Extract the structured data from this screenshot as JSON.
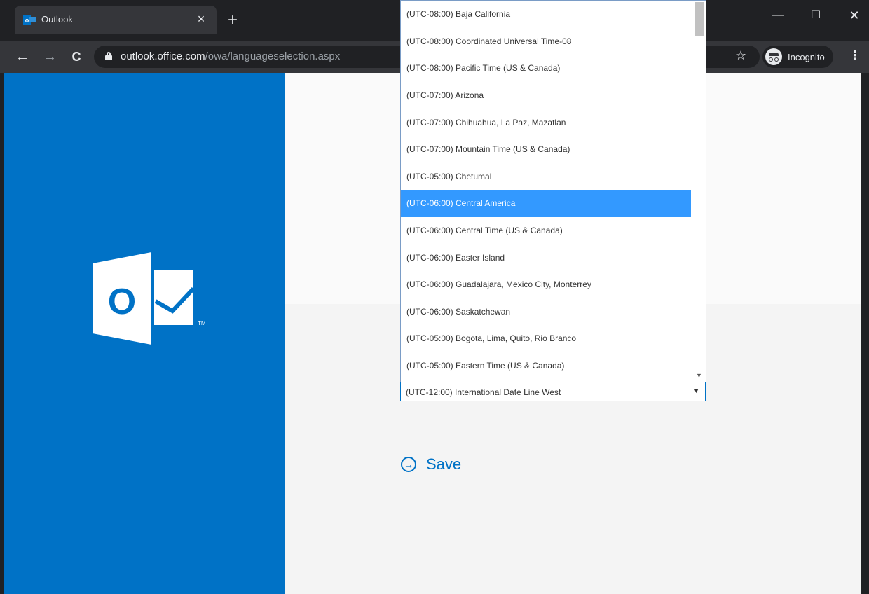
{
  "browser": {
    "tab_title": "Outlook",
    "tab_close": "×",
    "new_tab": "+",
    "url_host": "outlook.office.com",
    "url_path": "/owa/languageselection.aspx",
    "incognito_label": "Incognito",
    "window_controls": {
      "minimize": "—",
      "maximize": "☐",
      "close": "✕"
    },
    "nav": {
      "back": "←",
      "forward": "→",
      "reload": "C",
      "star": "☆",
      "menu": "⋮"
    }
  },
  "page": {
    "brand_color": "#0072c6",
    "logo_letter": "O",
    "logo_tm": "TM",
    "timezone_select": {
      "selected_value": "(UTC-12:00) International Date Line West",
      "arrow": "▼"
    },
    "save_label": "Save",
    "save_icon": "→"
  },
  "dropdown": {
    "highlighted_index": 7,
    "options": [
      "(UTC-08:00) Baja California",
      "(UTC-08:00) Coordinated Universal Time-08",
      "(UTC-08:00) Pacific Time (US & Canada)",
      "(UTC-07:00) Arizona",
      "(UTC-07:00) Chihuahua, La Paz, Mazatlan",
      "(UTC-07:00) Mountain Time (US & Canada)",
      "(UTC-05:00) Chetumal",
      "(UTC-06:00) Central America",
      "(UTC-06:00) Central Time (US & Canada)",
      "(UTC-06:00) Easter Island",
      "(UTC-06:00) Guadalajara, Mexico City, Monterrey",
      "(UTC-06:00) Saskatchewan",
      "(UTC-05:00) Bogota, Lima, Quito, Rio Branco",
      "(UTC-05:00) Eastern Time (US & Canada)"
    ]
  }
}
